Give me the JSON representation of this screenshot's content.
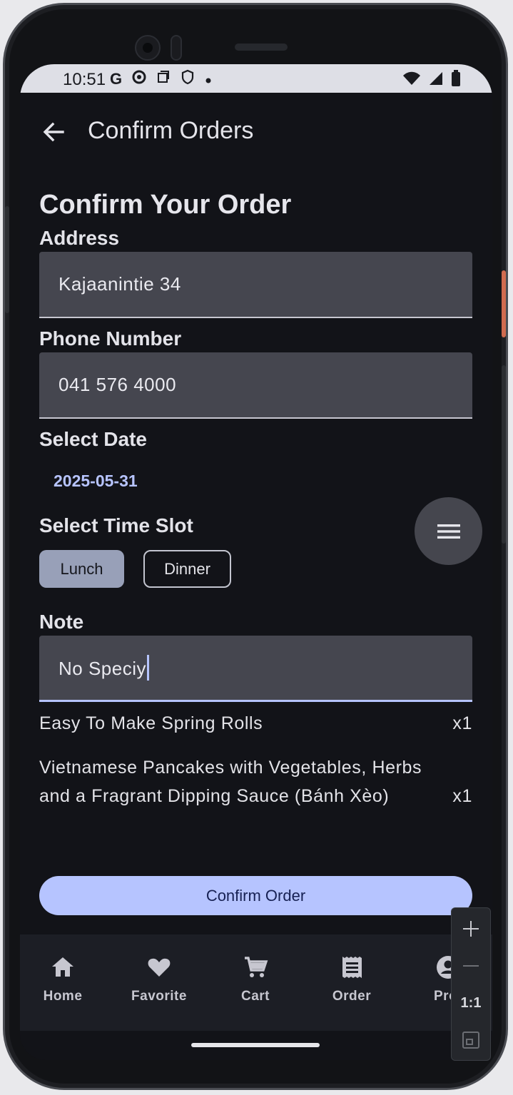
{
  "status_bar": {
    "time": "10:51",
    "left_icons": [
      "google-icon",
      "chrome-icon",
      "screenshot-icon",
      "shield-icon",
      "dot-icon"
    ],
    "right_icons": [
      "wifi-icon",
      "signal-icon",
      "battery-icon"
    ]
  },
  "topbar": {
    "title": "Confirm Orders"
  },
  "form": {
    "heading": "Confirm Your Order",
    "address_label": "Address",
    "address_value": "Kajaanintie 34",
    "phone_label": "Phone Number",
    "phone_value": "041 576 4000",
    "date_label": "Select Date",
    "date_value": "2025-05-31",
    "timeslot_label": "Select Time Slot",
    "timeslots": [
      {
        "label": "Lunch",
        "selected": true
      },
      {
        "label": "Dinner",
        "selected": false
      }
    ],
    "note_label": "Note",
    "note_value": "No Speciy"
  },
  "order_items": [
    {
      "name": "Easy To Make Spring Rolls",
      "qty": "x1"
    },
    {
      "name": "Vietnamese Pancakes with Vegetables, Herbs and a Fragrant Dipping Sauce (Bánh Xèo)",
      "qty": "x1"
    }
  ],
  "confirm_button": {
    "label": "Confirm Order"
  },
  "bottom_nav": {
    "items": [
      {
        "label": "Home",
        "icon": "home-icon"
      },
      {
        "label": "Favorite",
        "icon": "heart-icon"
      },
      {
        "label": "Cart",
        "icon": "cart-icon"
      },
      {
        "label": "Order",
        "icon": "receipt-icon"
      },
      {
        "label": "Prof",
        "icon": "profile-icon"
      }
    ]
  },
  "emulator_zoom": {
    "ratio_label": "1:1"
  },
  "colors": {
    "background": "#121318",
    "field": "#45464f",
    "accent": "#b6c4ff",
    "chip_selected": "#98a0b8",
    "nav_bg": "#1c1e25"
  }
}
